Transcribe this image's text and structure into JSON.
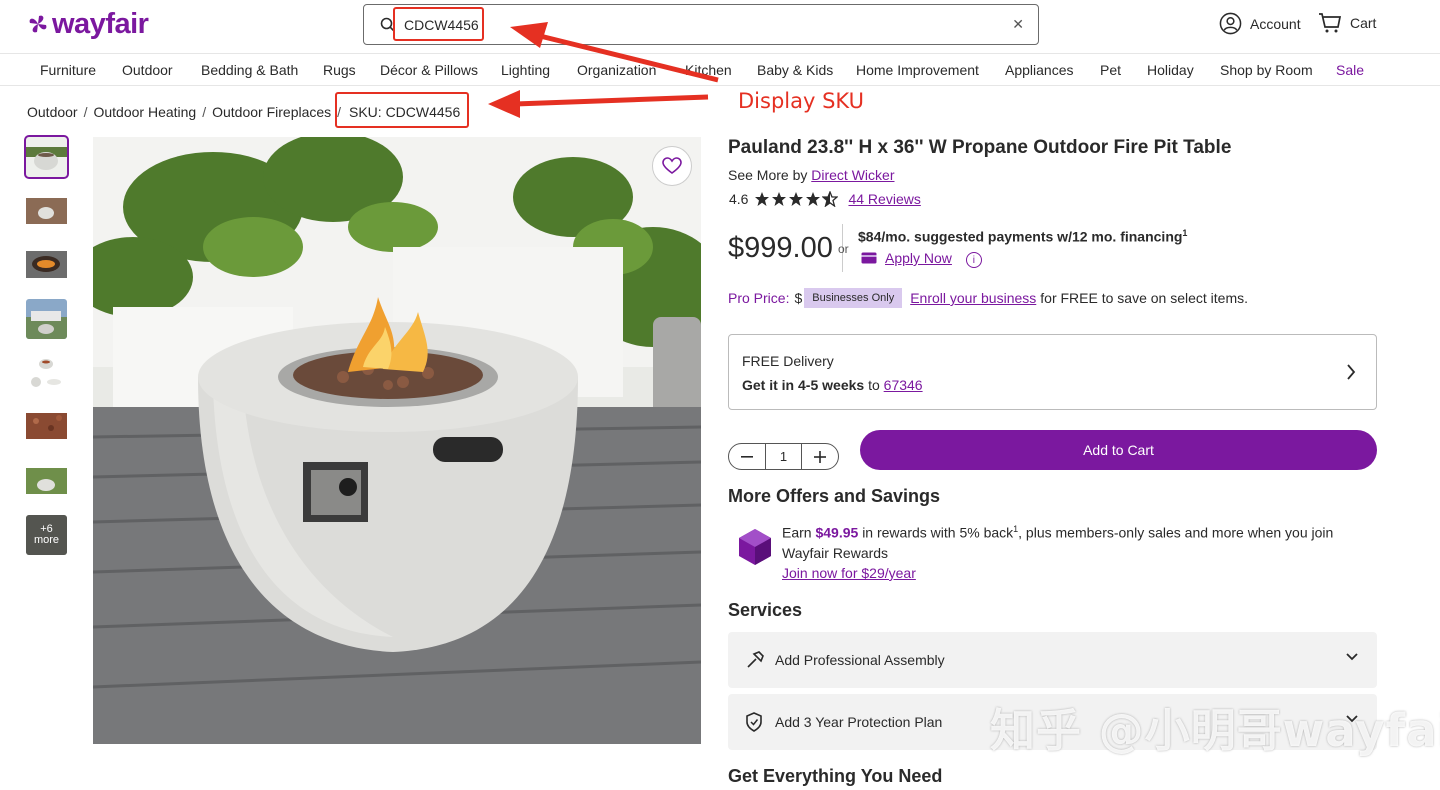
{
  "header": {
    "logo_text": "wayfair",
    "search_value": "CDCW4456",
    "account_label": "Account",
    "cart_label": "Cart",
    "brand_color": "#7b189f"
  },
  "nav": [
    "Furniture",
    "Outdoor",
    "Bedding & Bath",
    "Rugs",
    "Décor & Pillows",
    "Lighting",
    "Organization",
    "Kitchen",
    "Baby & Kids",
    "Home Improvement",
    "Appliances",
    "Pet",
    "Holiday",
    "Shop by Room",
    "Sale"
  ],
  "breadcrumb": [
    "Outdoor",
    "Outdoor Heating",
    "Outdoor Fireplaces"
  ],
  "sku": "SKU: CDCW4456",
  "annotation": {
    "label": "Display SKU",
    "color": "#e53022"
  },
  "gallery": {
    "more_count": "+6",
    "more_label": "more"
  },
  "product": {
    "title": "Pauland 23.8'' H x 36'' W Propane Outdoor Fire Pit Table",
    "see_more": "See More by",
    "brand": "Direct Wicker",
    "rating": "4.6",
    "stars": 4.5,
    "reviews": "44 Reviews",
    "price": "$999.00",
    "or": "or",
    "financing": "$84/mo. suggested payments w/12 mo. financing",
    "financing_sup": "1",
    "apply_now": "Apply Now",
    "pro_price_label": "Pro Price:",
    "pro_price_partial": "$",
    "businesses_only": "Businesses Only",
    "enroll_link": "Enroll your business",
    "enroll_rest": "for FREE to save on select items."
  },
  "delivery": {
    "line1": "FREE Delivery",
    "get_it": "Get it in",
    "weeks": "4-5 weeks",
    "to": "to",
    "zip": "67346"
  },
  "cart": {
    "quantity": "1",
    "add_label": "Add to Cart"
  },
  "offers": {
    "heading": "More Offers and Savings",
    "earn": "Earn",
    "amount": "$49.95",
    "text1": "in rewards with 5% back",
    "sup": "1",
    "text2": ", plus members-only sales and more when you join Wayfair Rewards",
    "join_link": "Join now for $29/year"
  },
  "services": {
    "heading": "Services",
    "items": [
      "Add Professional Assembly",
      "Add 3 Year Protection Plan"
    ]
  },
  "get_everything": "Get Everything You Need",
  "watermark": "知乎 @小明哥wayfair"
}
